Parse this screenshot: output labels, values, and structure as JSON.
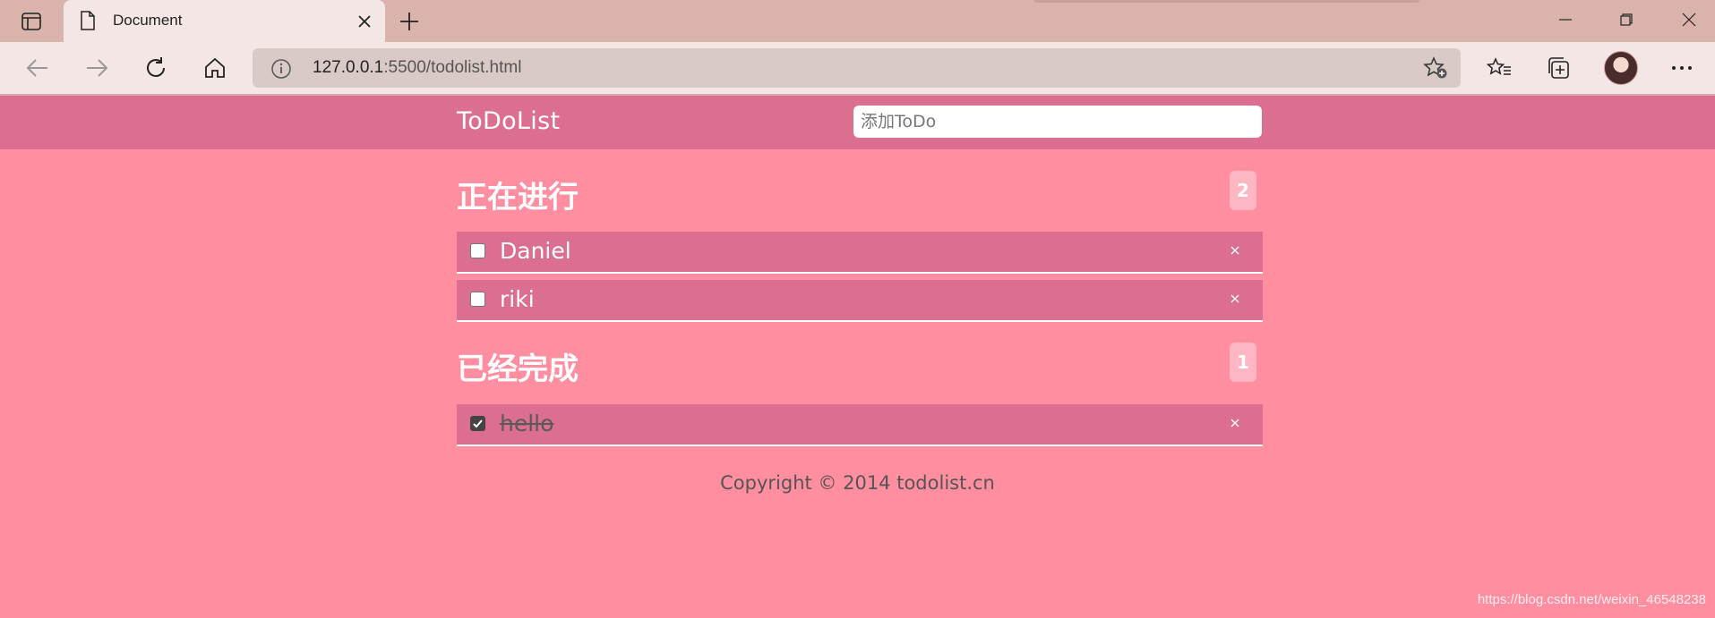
{
  "browser": {
    "tab_title": "Document",
    "url_host": "127.0.0.1",
    "url_rest": ":5500/todolist.html",
    "icons": {
      "tab_actions": "tab-actions-icon",
      "page": "page-icon",
      "close": "close-icon",
      "new_tab": "plus-icon",
      "back": "back-arrow-icon",
      "forward": "forward-arrow-icon",
      "refresh": "refresh-icon",
      "home": "home-icon",
      "info": "info-icon",
      "add_favorite": "star-plus-icon",
      "favorites": "favorites-icon",
      "collections": "collections-icon",
      "menu": "more-icon"
    }
  },
  "app": {
    "brand": "ToDoList",
    "input_placeholder": "添加ToDo",
    "ongoing": {
      "title": "正在进行",
      "count": "2",
      "items": [
        {
          "text": "Daniel",
          "done": false
        },
        {
          "text": "riki",
          "done": false
        }
      ]
    },
    "completed": {
      "title": "已经完成",
      "count": "1",
      "items": [
        {
          "text": "hello",
          "done": true
        }
      ]
    },
    "delete_label": "×",
    "footer": "Copyright © 2014 todolist.cn"
  },
  "watermark": "https://blog.csdn.net/weixin_46548238",
  "colors": {
    "page_bg": "#ff8ea0",
    "header_bg": "#dc6e8f",
    "item_bg": "#dc6e8f",
    "badge_bg": "#ffb6c3",
    "chrome_tabbar": "#d9b3ac",
    "chrome_toolbar": "#f3e6e5"
  }
}
